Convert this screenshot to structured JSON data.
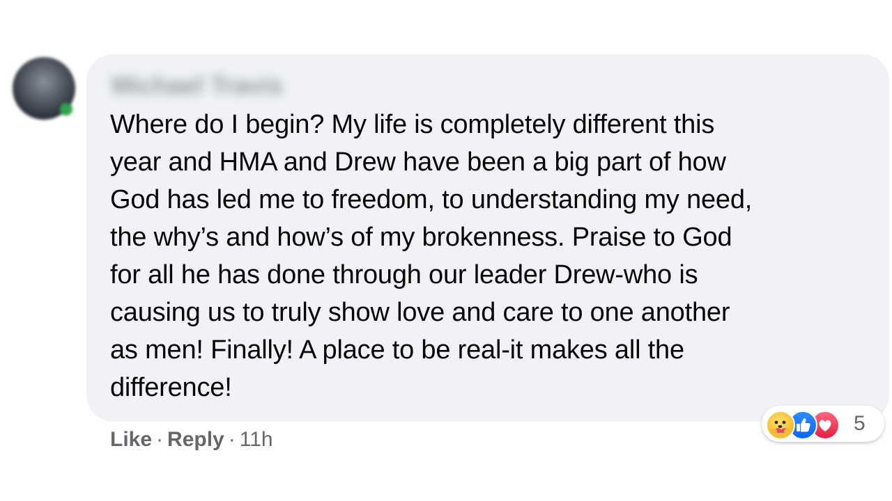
{
  "comment": {
    "author_name": "Michael Travis",
    "text": "Where do I begin? My life is completely different this\nyear and HMA and Drew have been a big part of how\nGod has led me to freedom, to understanding my need,\nthe why’s and how’s of my brokenness. Praise to God\nfor all he has done through our leader Drew-who is\ncausing us to truly show love and care to one another\nas men! Finally! A place to be real-it makes all the\ndifference!",
    "reactions": {
      "icons": [
        "care-icon",
        "like-icon",
        "love-icon"
      ],
      "count": "5"
    },
    "actions": {
      "like_label": "Like",
      "reply_label": "Reply",
      "separator": "·",
      "timestamp": "11h"
    }
  },
  "colors": {
    "bubble_background": "#f0f2f5",
    "text": "#050505",
    "secondary_text": "#65676b",
    "like_blue": "#0866ff",
    "love_red": "#e61e40",
    "care_yellow": "#f7c33b",
    "online_green": "#31a24c"
  }
}
